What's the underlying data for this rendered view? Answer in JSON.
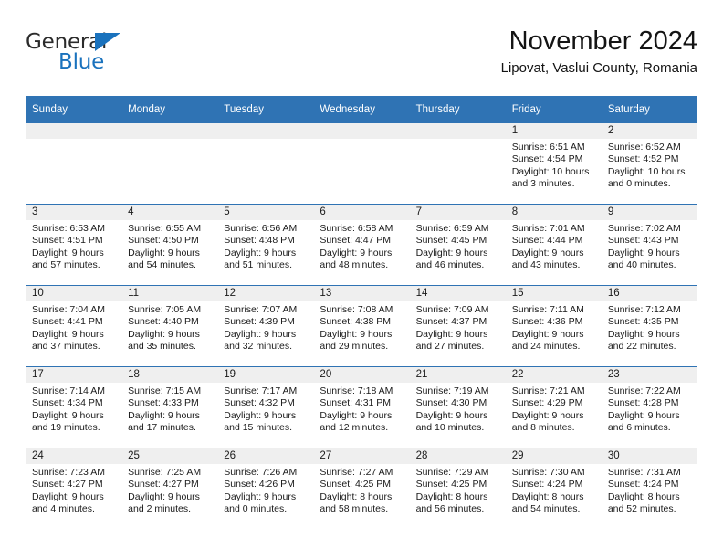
{
  "brand": {
    "name_top": "General",
    "name_bottom": "Blue",
    "triangle_icon": "triangle-icon",
    "color_dark": "#2b2b2b",
    "color_blue": "#1a72bd"
  },
  "header": {
    "title": "November 2024",
    "subtitle": "Lipovat, Vaslui County, Romania"
  },
  "theme": {
    "header_blue": "#2f73b4",
    "daynum_band": "#efefef",
    "row_divider": "#2f73b4"
  },
  "calendar": {
    "weekday_headers": [
      "Sunday",
      "Monday",
      "Tuesday",
      "Wednesday",
      "Thursday",
      "Friday",
      "Saturday"
    ],
    "labels": {
      "sunrise": "Sunrise:",
      "sunset": "Sunset:",
      "daylight": "Daylight:"
    },
    "weeks": [
      [
        {
          "day": "",
          "blank": true
        },
        {
          "day": "",
          "blank": true
        },
        {
          "day": "",
          "blank": true
        },
        {
          "day": "",
          "blank": true
        },
        {
          "day": "",
          "blank": true
        },
        {
          "day": "1",
          "sunrise": "Sunrise: 6:51 AM",
          "sunset": "Sunset: 4:54 PM",
          "daylight1": "Daylight: 10 hours",
          "daylight2": "and 3 minutes."
        },
        {
          "day": "2",
          "sunrise": "Sunrise: 6:52 AM",
          "sunset": "Sunset: 4:52 PM",
          "daylight1": "Daylight: 10 hours",
          "daylight2": "and 0 minutes."
        }
      ],
      [
        {
          "day": "3",
          "sunrise": "Sunrise: 6:53 AM",
          "sunset": "Sunset: 4:51 PM",
          "daylight1": "Daylight: 9 hours",
          "daylight2": "and 57 minutes."
        },
        {
          "day": "4",
          "sunrise": "Sunrise: 6:55 AM",
          "sunset": "Sunset: 4:50 PM",
          "daylight1": "Daylight: 9 hours",
          "daylight2": "and 54 minutes."
        },
        {
          "day": "5",
          "sunrise": "Sunrise: 6:56 AM",
          "sunset": "Sunset: 4:48 PM",
          "daylight1": "Daylight: 9 hours",
          "daylight2": "and 51 minutes."
        },
        {
          "day": "6",
          "sunrise": "Sunrise: 6:58 AM",
          "sunset": "Sunset: 4:47 PM",
          "daylight1": "Daylight: 9 hours",
          "daylight2": "and 48 minutes."
        },
        {
          "day": "7",
          "sunrise": "Sunrise: 6:59 AM",
          "sunset": "Sunset: 4:45 PM",
          "daylight1": "Daylight: 9 hours",
          "daylight2": "and 46 minutes."
        },
        {
          "day": "8",
          "sunrise": "Sunrise: 7:01 AM",
          "sunset": "Sunset: 4:44 PM",
          "daylight1": "Daylight: 9 hours",
          "daylight2": "and 43 minutes."
        },
        {
          "day": "9",
          "sunrise": "Sunrise: 7:02 AM",
          "sunset": "Sunset: 4:43 PM",
          "daylight1": "Daylight: 9 hours",
          "daylight2": "and 40 minutes."
        }
      ],
      [
        {
          "day": "10",
          "sunrise": "Sunrise: 7:04 AM",
          "sunset": "Sunset: 4:41 PM",
          "daylight1": "Daylight: 9 hours",
          "daylight2": "and 37 minutes."
        },
        {
          "day": "11",
          "sunrise": "Sunrise: 7:05 AM",
          "sunset": "Sunset: 4:40 PM",
          "daylight1": "Daylight: 9 hours",
          "daylight2": "and 35 minutes."
        },
        {
          "day": "12",
          "sunrise": "Sunrise: 7:07 AM",
          "sunset": "Sunset: 4:39 PM",
          "daylight1": "Daylight: 9 hours",
          "daylight2": "and 32 minutes."
        },
        {
          "day": "13",
          "sunrise": "Sunrise: 7:08 AM",
          "sunset": "Sunset: 4:38 PM",
          "daylight1": "Daylight: 9 hours",
          "daylight2": "and 29 minutes."
        },
        {
          "day": "14",
          "sunrise": "Sunrise: 7:09 AM",
          "sunset": "Sunset: 4:37 PM",
          "daylight1": "Daylight: 9 hours",
          "daylight2": "and 27 minutes."
        },
        {
          "day": "15",
          "sunrise": "Sunrise: 7:11 AM",
          "sunset": "Sunset: 4:36 PM",
          "daylight1": "Daylight: 9 hours",
          "daylight2": "and 24 minutes."
        },
        {
          "day": "16",
          "sunrise": "Sunrise: 7:12 AM",
          "sunset": "Sunset: 4:35 PM",
          "daylight1": "Daylight: 9 hours",
          "daylight2": "and 22 minutes."
        }
      ],
      [
        {
          "day": "17",
          "sunrise": "Sunrise: 7:14 AM",
          "sunset": "Sunset: 4:34 PM",
          "daylight1": "Daylight: 9 hours",
          "daylight2": "and 19 minutes."
        },
        {
          "day": "18",
          "sunrise": "Sunrise: 7:15 AM",
          "sunset": "Sunset: 4:33 PM",
          "daylight1": "Daylight: 9 hours",
          "daylight2": "and 17 minutes."
        },
        {
          "day": "19",
          "sunrise": "Sunrise: 7:17 AM",
          "sunset": "Sunset: 4:32 PM",
          "daylight1": "Daylight: 9 hours",
          "daylight2": "and 15 minutes."
        },
        {
          "day": "20",
          "sunrise": "Sunrise: 7:18 AM",
          "sunset": "Sunset: 4:31 PM",
          "daylight1": "Daylight: 9 hours",
          "daylight2": "and 12 minutes."
        },
        {
          "day": "21",
          "sunrise": "Sunrise: 7:19 AM",
          "sunset": "Sunset: 4:30 PM",
          "daylight1": "Daylight: 9 hours",
          "daylight2": "and 10 minutes."
        },
        {
          "day": "22",
          "sunrise": "Sunrise: 7:21 AM",
          "sunset": "Sunset: 4:29 PM",
          "daylight1": "Daylight: 9 hours",
          "daylight2": "and 8 minutes."
        },
        {
          "day": "23",
          "sunrise": "Sunrise: 7:22 AM",
          "sunset": "Sunset: 4:28 PM",
          "daylight1": "Daylight: 9 hours",
          "daylight2": "and 6 minutes."
        }
      ],
      [
        {
          "day": "24",
          "sunrise": "Sunrise: 7:23 AM",
          "sunset": "Sunset: 4:27 PM",
          "daylight1": "Daylight: 9 hours",
          "daylight2": "and 4 minutes."
        },
        {
          "day": "25",
          "sunrise": "Sunrise: 7:25 AM",
          "sunset": "Sunset: 4:27 PM",
          "daylight1": "Daylight: 9 hours",
          "daylight2": "and 2 minutes."
        },
        {
          "day": "26",
          "sunrise": "Sunrise: 7:26 AM",
          "sunset": "Sunset: 4:26 PM",
          "daylight1": "Daylight: 9 hours",
          "daylight2": "and 0 minutes."
        },
        {
          "day": "27",
          "sunrise": "Sunrise: 7:27 AM",
          "sunset": "Sunset: 4:25 PM",
          "daylight1": "Daylight: 8 hours",
          "daylight2": "and 58 minutes."
        },
        {
          "day": "28",
          "sunrise": "Sunrise: 7:29 AM",
          "sunset": "Sunset: 4:25 PM",
          "daylight1": "Daylight: 8 hours",
          "daylight2": "and 56 minutes."
        },
        {
          "day": "29",
          "sunrise": "Sunrise: 7:30 AM",
          "sunset": "Sunset: 4:24 PM",
          "daylight1": "Daylight: 8 hours",
          "daylight2": "and 54 minutes."
        },
        {
          "day": "30",
          "sunrise": "Sunrise: 7:31 AM",
          "sunset": "Sunset: 4:24 PM",
          "daylight1": "Daylight: 8 hours",
          "daylight2": "and 52 minutes."
        }
      ]
    ]
  }
}
